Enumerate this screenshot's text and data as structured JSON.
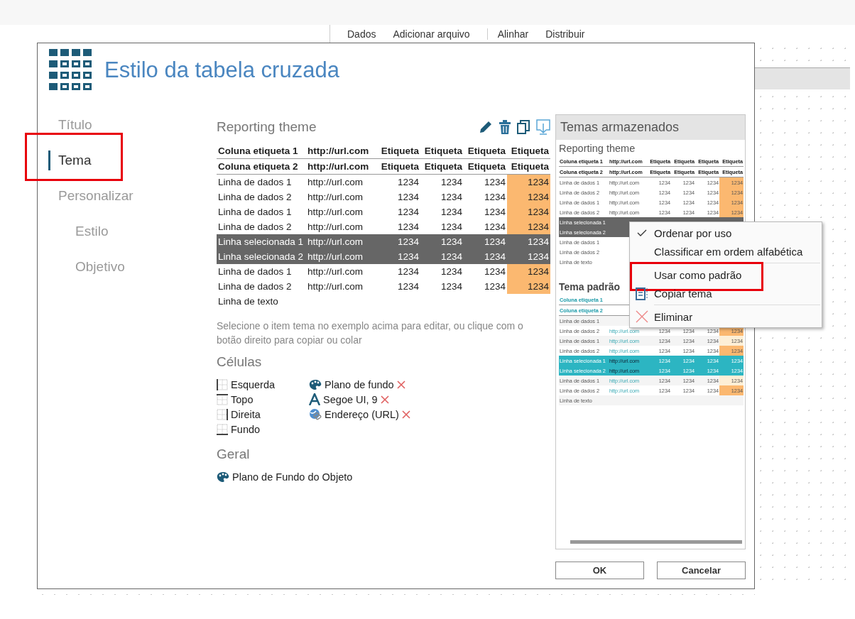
{
  "background_toolbar": {
    "items": [
      "Dados",
      "Adicionar arquivo",
      "Alinhar",
      "Distribuir"
    ]
  },
  "dialog": {
    "title": "Estilo da tabela cruzada",
    "nav": [
      {
        "label": "Título",
        "selected": false,
        "highlighted": false
      },
      {
        "label": "Tema",
        "selected": true,
        "highlighted": true
      },
      {
        "label": "Personalizar",
        "selected": false,
        "highlighted": false,
        "children": [
          {
            "label": "Estilo",
            "selected": false,
            "highlighted": false
          },
          {
            "label": "Objetivo",
            "selected": false,
            "highlighted": false
          }
        ]
      }
    ],
    "theme": {
      "name": "Reporting theme",
      "kind": "dark",
      "rows": [
        {
          "kind": "header",
          "cells": [
            "Coluna etiqueta 1",
            "http://url.com",
            "Etiqueta",
            "Etiqueta",
            "Etiqueta",
            "Etiqueta"
          ]
        },
        {
          "kind": "header",
          "cells": [
            "Coluna etiqueta 2",
            "http://url.com",
            "Etiqueta",
            "Etiqueta",
            "Etiqueta",
            "Etiqueta"
          ]
        },
        {
          "kind": "data",
          "cells": [
            "Linha de dados 1",
            "http://url.com",
            "1234",
            "1234",
            "1234",
            "1234"
          ]
        },
        {
          "kind": "data",
          "cells": [
            "Linha de dados 2",
            "http://url.com",
            "1234",
            "1234",
            "1234",
            "1234"
          ]
        },
        {
          "kind": "data",
          "cells": [
            "Linha de dados 1",
            "http://url.com",
            "1234",
            "1234",
            "1234",
            "1234"
          ]
        },
        {
          "kind": "data",
          "cells": [
            "Linha de dados 2",
            "http://url.com",
            "1234",
            "1234",
            "1234",
            "1234"
          ]
        },
        {
          "kind": "selected",
          "cells": [
            "Linha selecionada 1",
            "http://url.com",
            "1234",
            "1234",
            "1234",
            "1234"
          ]
        },
        {
          "kind": "selected",
          "cells": [
            "Linha selecionada 2",
            "http://url.com",
            "1234",
            "1234",
            "1234",
            "1234"
          ]
        },
        {
          "kind": "data",
          "cells": [
            "Linha de dados 1",
            "http://url.com",
            "1234",
            "1234",
            "1234",
            "1234"
          ]
        },
        {
          "kind": "data",
          "cells": [
            "Linha de dados 2",
            "http://url.com",
            "1234",
            "1234",
            "1234",
            "1234"
          ]
        },
        {
          "kind": "text",
          "cells": [
            "Linha de texto"
          ]
        }
      ],
      "hint": "Selecione o item tema no exemplo acima para editar, ou clique com o botão direito para copiar ou colar"
    },
    "cells": {
      "heading": "Células",
      "borders": [
        {
          "label": "Esquerda",
          "kind": "left"
        },
        {
          "label": "Topo",
          "kind": "top"
        },
        {
          "label": "Direita",
          "kind": "right"
        },
        {
          "label": "Fundo",
          "kind": "bottom"
        }
      ],
      "properties": [
        {
          "label": "Plano de fundo",
          "kind": "background"
        },
        {
          "label": "Segoe UI, 9",
          "kind": "font"
        },
        {
          "label": "Endereço (URL)",
          "kind": "url"
        }
      ]
    },
    "general": {
      "heading": "Geral",
      "items": [
        {
          "label": "Plano de Fundo do Objeto"
        }
      ]
    },
    "stored_themes": {
      "title": "Temas armazenados",
      "themes": [
        {
          "name": "Reporting theme",
          "kind": "dark",
          "rows": [
            {
              "kind": "header",
              "cells": [
                "Coluna etiqueta 1",
                "http://url.com",
                "Etiqueta",
                "Etiqueta",
                "Etiqueta",
                "Etiqueta"
              ]
            },
            {
              "kind": "header",
              "cells": [
                "Coluna etiqueta 2",
                "http://url.com",
                "Etiqueta",
                "Etiqueta",
                "Etiqueta",
                "Etiqueta"
              ]
            },
            {
              "kind": "data",
              "cells": [
                "Linha de dados 1",
                "http://url.com",
                "1234",
                "1234",
                "1234",
                "1234"
              ]
            },
            {
              "kind": "data",
              "cells": [
                "Linha de dados 2",
                "http://url.com",
                "1234",
                "1234",
                "1234",
                "1234"
              ]
            },
            {
              "kind": "data",
              "cells": [
                "Linha de dados 1",
                "http://url.com",
                "1234",
                "1234",
                "1234",
                "1234"
              ]
            },
            {
              "kind": "data",
              "cells": [
                "Linha de dados 2",
                "http://url.com",
                "1234",
                "1234",
                "1234",
                "1234"
              ]
            },
            {
              "kind": "selected",
              "cells": [
                "Linha selecionada 1"
              ]
            },
            {
              "kind": "selected",
              "cells": [
                "Linha selecionada 2"
              ]
            },
            {
              "kind": "data",
              "cells": [
                "Linha de dados 1"
              ]
            },
            {
              "kind": "data",
              "cells": [
                "Linha de dados 2"
              ]
            },
            {
              "kind": "text",
              "cells": [
                "Linha de texto"
              ]
            }
          ]
        },
        {
          "name": "Tema padrão",
          "kind": "teal",
          "rows": [
            {
              "kind": "header",
              "cells": [
                "Coluna etiqueta 1"
              ]
            },
            {
              "kind": "header",
              "cells": [
                "Coluna etiqueta 2"
              ]
            },
            {
              "kind": "data_alt",
              "cells": [
                "Linha de dados 1"
              ]
            },
            {
              "kind": "data",
              "cells": [
                "Linha de dados 2",
                "http://url.com",
                "1234",
                "1234",
                "1234",
                "1234"
              ]
            },
            {
              "kind": "data_alt",
              "cells": [
                "Linha de dados 1",
                "http://url.com",
                "1234",
                "1234",
                "1234",
                "1234"
              ]
            },
            {
              "kind": "data",
              "cells": [
                "Linha de dados 2",
                "http://url.com",
                "1234",
                "1234",
                "1234",
                "1234"
              ]
            },
            {
              "kind": "selected",
              "cells": [
                "Linha selecionada 1",
                "http://url.com",
                "1234",
                "1234",
                "1234",
                "1234"
              ]
            },
            {
              "kind": "selected",
              "cells": [
                "Linha selecionada 2",
                "http://url.com",
                "1234",
                "1234",
                "1234",
                "1234"
              ]
            },
            {
              "kind": "data_alt",
              "cells": [
                "Linha de dados 1",
                "http://url.com",
                "1234",
                "1234",
                "1234",
                "1234"
              ]
            },
            {
              "kind": "data",
              "cells": [
                "Linha de dados 2",
                "http://url.com",
                "1234",
                "1234",
                "1234",
                "1234"
              ]
            },
            {
              "kind": "text",
              "cells": [
                "Linha de texto"
              ]
            }
          ]
        }
      ]
    },
    "buttons": [
      "OK",
      "Cancelar"
    ]
  },
  "context_menu": [
    {
      "label": "Ordenar por uso",
      "kind": "option",
      "checked": true,
      "separator_before": false,
      "highlighted": false
    },
    {
      "label": "Classificar em ordem alfabética",
      "kind": "option",
      "checked": false,
      "separator_before": false,
      "highlighted": false
    },
    {
      "label": "Usar como padrão",
      "kind": "plain",
      "checked": false,
      "separator_before": true,
      "highlighted": true
    },
    {
      "label": "Copiar tema",
      "kind": "copy",
      "checked": false,
      "separator_before": false,
      "highlighted": false
    },
    {
      "label": "Eliminar",
      "kind": "delete",
      "checked": false,
      "separator_before": true,
      "highlighted": false
    }
  ]
}
